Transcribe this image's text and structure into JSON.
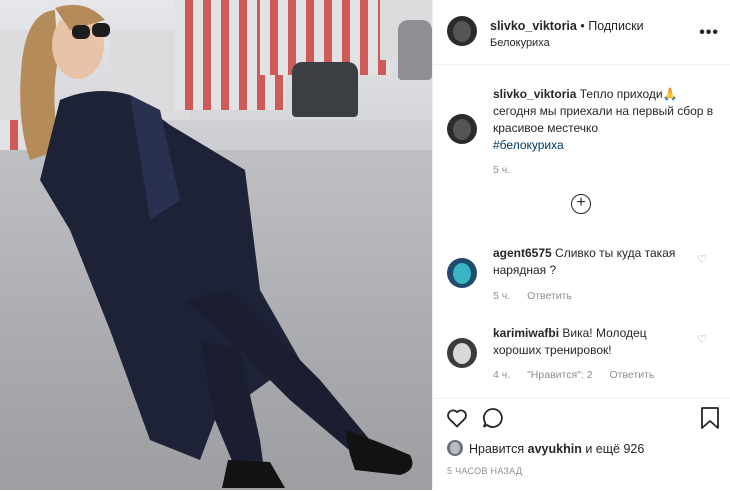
{
  "post": {
    "username": "slivko_viktoria",
    "separator": "•",
    "follow_label": "Подписки",
    "location": "Белокуриха",
    "more_label": "•••"
  },
  "caption": {
    "username": "slivko_viktoria",
    "text": "Тепло приходи🙏 сегодня мы приехали на первый сбор в красивое местечко",
    "hashtag": "#белокуриха",
    "time": "5 ч."
  },
  "load_more_label": "+",
  "comments": [
    {
      "username": "agent6575",
      "text": "Сливко ты куда такая нарядная ?",
      "time": "5 ч.",
      "reply_label": "Ответить"
    },
    {
      "username": "karimiwafbi",
      "text": "Вика! Молодец хороших тренировок!",
      "time": "4 ч.",
      "likes_label": "\"Нравится\": 2",
      "reply_label": "Ответить"
    }
  ],
  "likes": {
    "prefix": "Нравится",
    "user": "avyukhin",
    "suffix": "и ещё 926"
  },
  "posted_ago": "5 ЧАСОВ НАЗАД",
  "colors": {
    "text": "#262626",
    "secondary": "#8e8e8e",
    "hashtag": "#00376b",
    "border": "#efefef"
  },
  "icons": {
    "like": "heart-icon",
    "comment": "comment-icon",
    "save": "bookmark-icon",
    "load_more": "plus-circle-icon",
    "more": "more-options-icon"
  }
}
